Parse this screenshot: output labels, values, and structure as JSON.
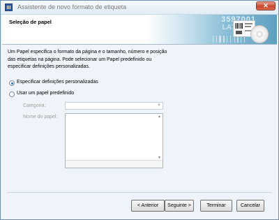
{
  "window": {
    "title": "Assistente de novo formato de etiqueta"
  },
  "header": {
    "title": "Seleção de papel",
    "banner_number_1": "3597001",
    "banner_number_2": "LA7-118"
  },
  "intro_text": "Um Papel especifica o formato da página e o tamanho, número e posição das etiquetas na página. Pode selecionar um Papel predefinido ou especificar definições personalizadas.",
  "options": {
    "custom": {
      "label": "Especificar definições personalizadas",
      "selected": true
    },
    "predefined": {
      "label": "Usar um papel predefinido",
      "selected": false
    }
  },
  "fields": {
    "category_label": "Categoria:",
    "category_value": "",
    "paper_name_label": "Nome do papel:"
  },
  "buttons": {
    "back": "< Anterior",
    "next": "Seguinte >",
    "finish": "Terminar",
    "cancel": "Cancelar"
  },
  "colors": {
    "accent": "#2f72c2",
    "close": "#c7462d",
    "banner": "#5d9fbf"
  }
}
